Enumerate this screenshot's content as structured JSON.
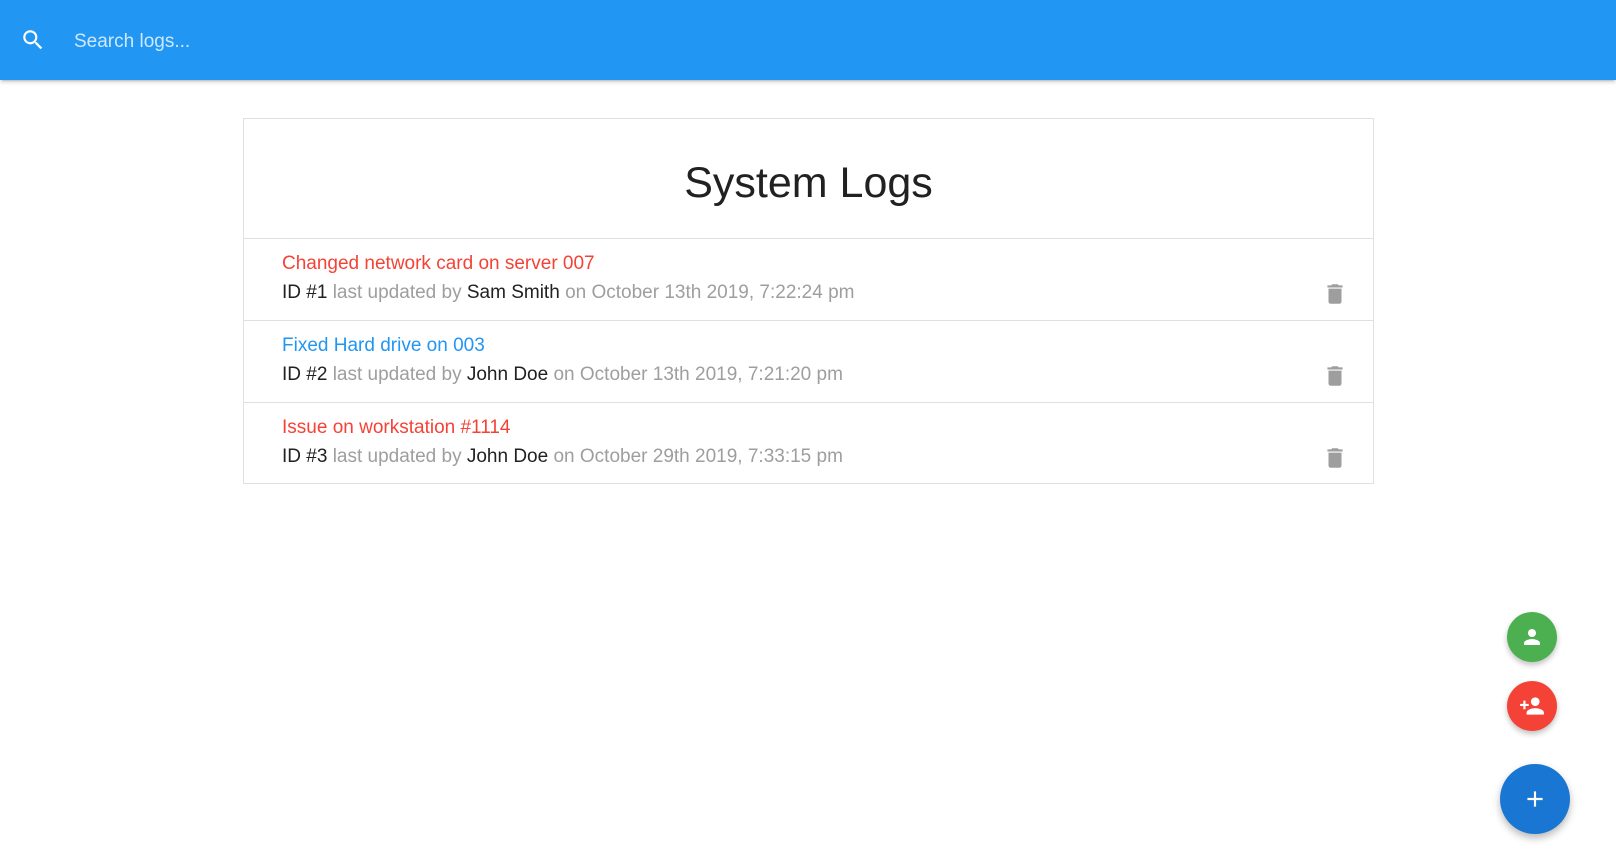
{
  "navbar": {
    "search_placeholder": "Search logs...",
    "search_icon": "search-icon",
    "background_color": "#2196f3"
  },
  "main": {
    "title": "System Logs",
    "logs": [
      {
        "message": "Changed network card on server 007",
        "attention": true,
        "id_label": "ID #1",
        "updated_by_label": "last updated by",
        "tech": "Sam Smith",
        "date_label": "on October 13th 2019, 7:22:24 pm",
        "message_color": "#f44336"
      },
      {
        "message": "Fixed Hard drive on 003",
        "attention": false,
        "id_label": "ID #2",
        "updated_by_label": "last updated by",
        "tech": "John Doe",
        "date_label": "on October 13th 2019, 7:21:20 pm",
        "message_color": "#2196f3"
      },
      {
        "message": "Issue on workstation #1114",
        "attention": true,
        "id_label": "ID #3",
        "updated_by_label": "last updated by",
        "tech": "John Doe",
        "date_label": "on October 29th 2019, 7:33:15 pm",
        "message_color": "#f44336"
      }
    ],
    "delete_icon": "trash-icon"
  },
  "fab": {
    "users_icon": "person-icon",
    "users_color": "#4caf50",
    "add_user_icon": "person-add-icon",
    "add_user_color": "#f44336",
    "add_log_icon": "plus-icon",
    "add_log_color": "#1976d2"
  }
}
